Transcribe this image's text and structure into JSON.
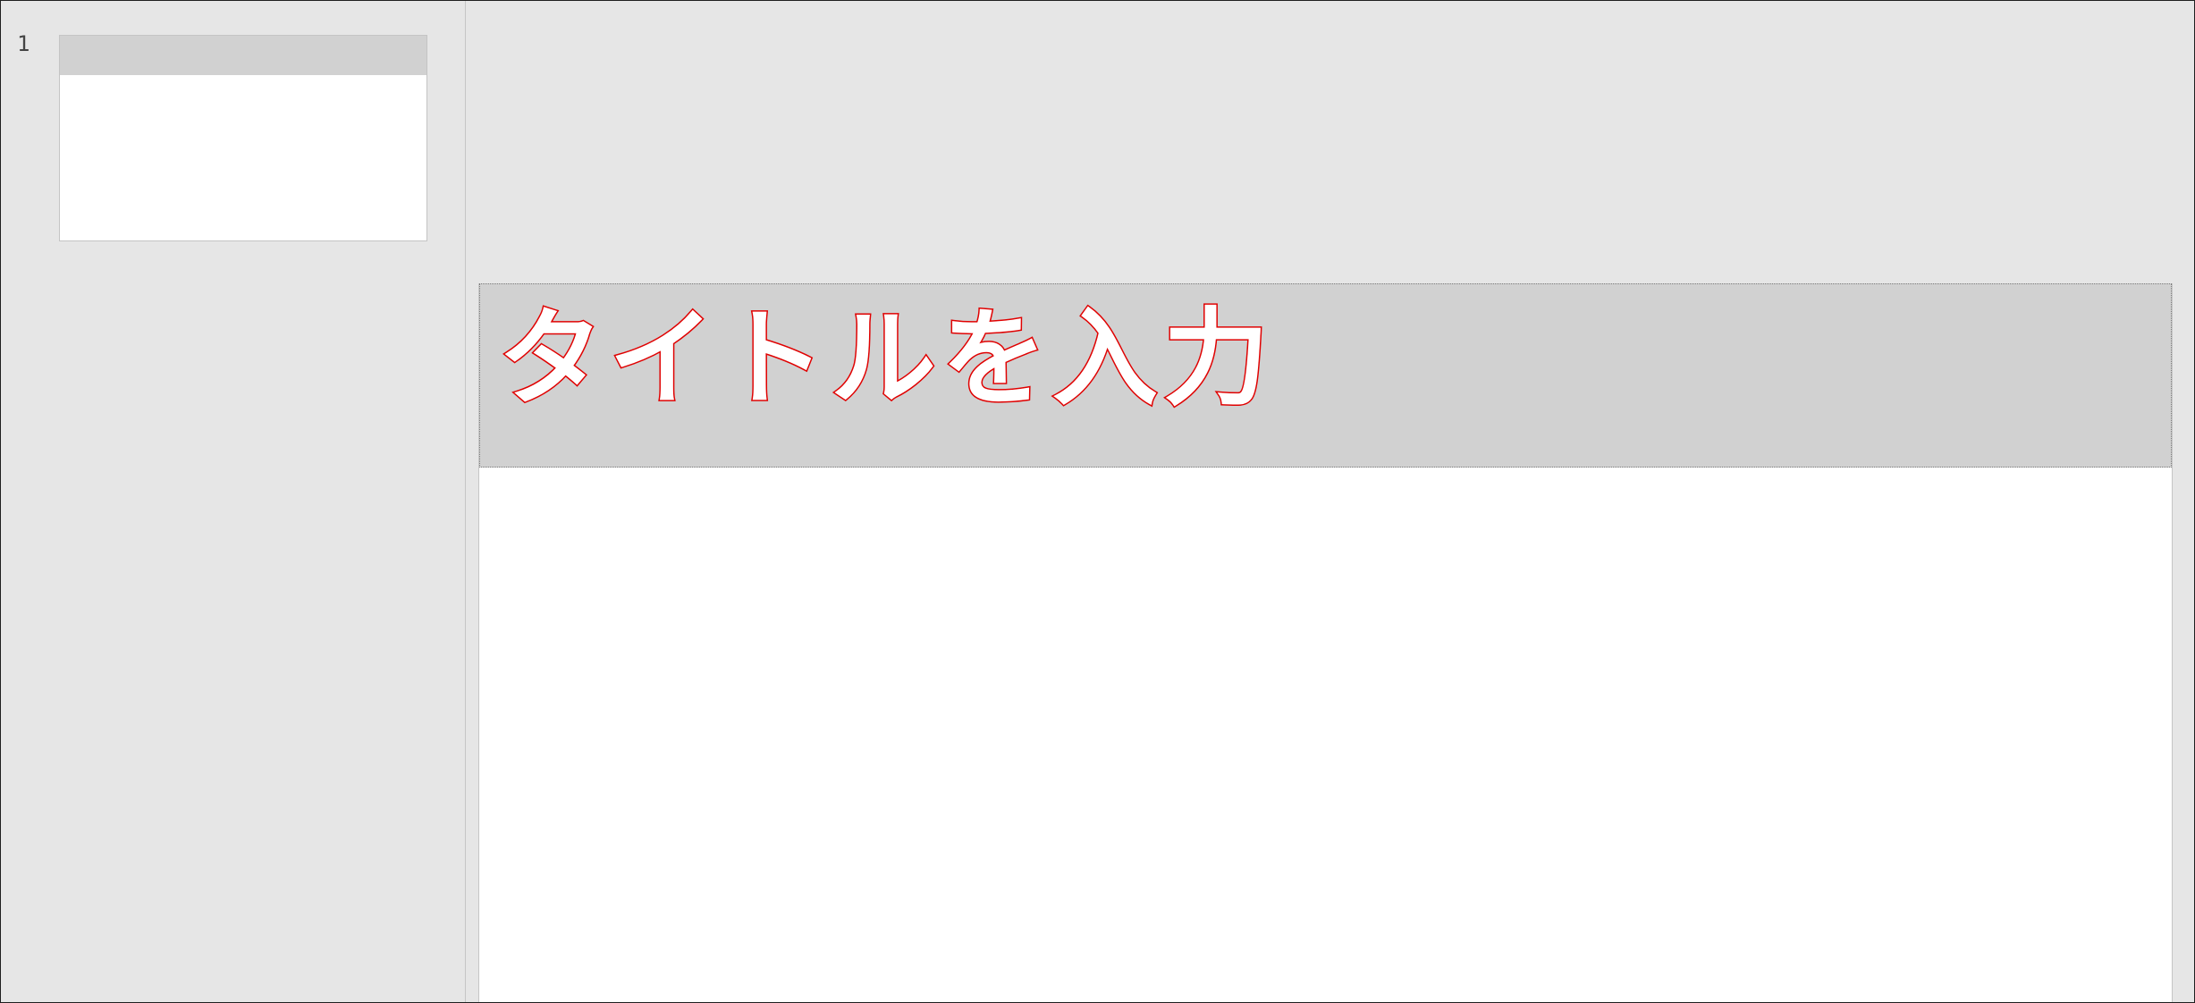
{
  "thumbnail_pane": {
    "slides": [
      {
        "number": "1"
      }
    ]
  },
  "slide": {
    "title_placeholder": "タイトルを入力"
  },
  "colors": {
    "workspace_bg": "#e6e6e6",
    "slide_bg": "#ffffff",
    "title_band": "#d1d1d1",
    "title_outline": "#e00000",
    "title_fill": "#ffffff"
  }
}
